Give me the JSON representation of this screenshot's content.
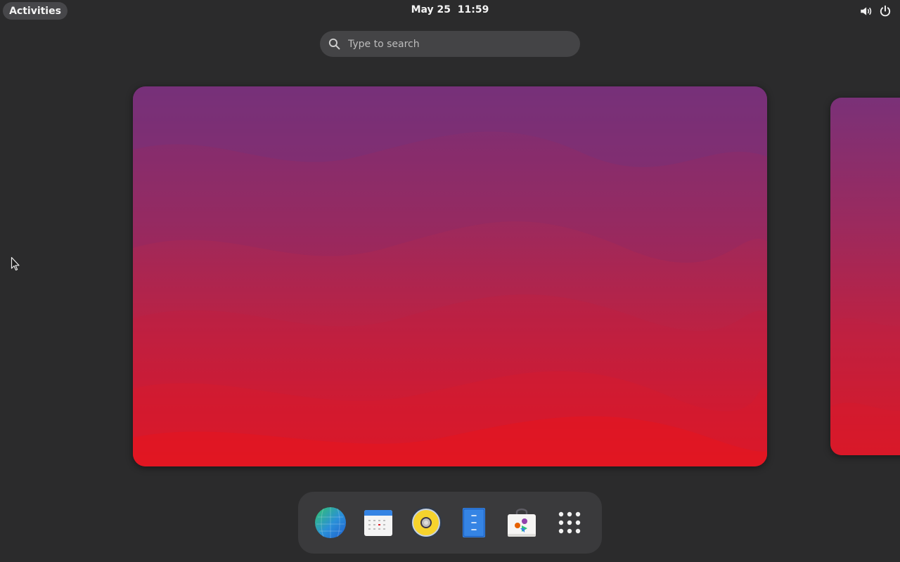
{
  "topbar": {
    "activities_label": "Activities",
    "date": "May 25",
    "time": "11:59",
    "tray_icons": [
      "volume-icon",
      "power-icon"
    ]
  },
  "search": {
    "placeholder": "Type to search",
    "icon": "search-icon"
  },
  "workspaces": [
    {
      "name": "workspace-current",
      "gradient": [
        "#7a3178",
        "#a0285a",
        "#c91f3c",
        "#e5151f"
      ]
    },
    {
      "name": "workspace-next",
      "gradient": [
        "#7a3178",
        "#a0285a",
        "#c91f3c",
        "#e0161f"
      ]
    }
  ],
  "dash": {
    "items": [
      {
        "name": "web-browser",
        "icon": "globe-icon"
      },
      {
        "name": "calendar",
        "icon": "calendar-icon"
      },
      {
        "name": "music-player",
        "icon": "speaker-icon"
      },
      {
        "name": "text-editor",
        "icon": "document-icon"
      },
      {
        "name": "software",
        "icon": "shopping-bag-icon"
      },
      {
        "name": "show-apps",
        "icon": "app-grid-icon"
      }
    ]
  },
  "colors": {
    "background": "#2b2b2c",
    "panel_button": "#47474a",
    "search_bg": "#444446",
    "dash_bg": "#3a3a3c"
  }
}
